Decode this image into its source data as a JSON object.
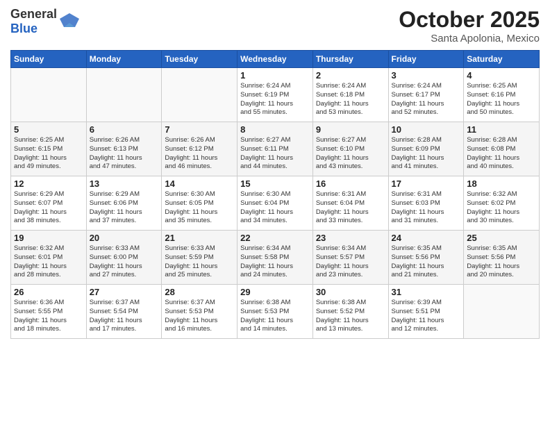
{
  "header": {
    "logo_general": "General",
    "logo_blue": "Blue",
    "month": "October 2025",
    "location": "Santa Apolonia, Mexico"
  },
  "weekdays": [
    "Sunday",
    "Monday",
    "Tuesday",
    "Wednesday",
    "Thursday",
    "Friday",
    "Saturday"
  ],
  "weeks": [
    [
      {
        "day": "",
        "info": ""
      },
      {
        "day": "",
        "info": ""
      },
      {
        "day": "",
        "info": ""
      },
      {
        "day": "1",
        "info": "Sunrise: 6:24 AM\nSunset: 6:19 PM\nDaylight: 11 hours\nand 55 minutes."
      },
      {
        "day": "2",
        "info": "Sunrise: 6:24 AM\nSunset: 6:18 PM\nDaylight: 11 hours\nand 53 minutes."
      },
      {
        "day": "3",
        "info": "Sunrise: 6:24 AM\nSunset: 6:17 PM\nDaylight: 11 hours\nand 52 minutes."
      },
      {
        "day": "4",
        "info": "Sunrise: 6:25 AM\nSunset: 6:16 PM\nDaylight: 11 hours\nand 50 minutes."
      }
    ],
    [
      {
        "day": "5",
        "info": "Sunrise: 6:25 AM\nSunset: 6:15 PM\nDaylight: 11 hours\nand 49 minutes."
      },
      {
        "day": "6",
        "info": "Sunrise: 6:26 AM\nSunset: 6:13 PM\nDaylight: 11 hours\nand 47 minutes."
      },
      {
        "day": "7",
        "info": "Sunrise: 6:26 AM\nSunset: 6:12 PM\nDaylight: 11 hours\nand 46 minutes."
      },
      {
        "day": "8",
        "info": "Sunrise: 6:27 AM\nSunset: 6:11 PM\nDaylight: 11 hours\nand 44 minutes."
      },
      {
        "day": "9",
        "info": "Sunrise: 6:27 AM\nSunset: 6:10 PM\nDaylight: 11 hours\nand 43 minutes."
      },
      {
        "day": "10",
        "info": "Sunrise: 6:28 AM\nSunset: 6:09 PM\nDaylight: 11 hours\nand 41 minutes."
      },
      {
        "day": "11",
        "info": "Sunrise: 6:28 AM\nSunset: 6:08 PM\nDaylight: 11 hours\nand 40 minutes."
      }
    ],
    [
      {
        "day": "12",
        "info": "Sunrise: 6:29 AM\nSunset: 6:07 PM\nDaylight: 11 hours\nand 38 minutes."
      },
      {
        "day": "13",
        "info": "Sunrise: 6:29 AM\nSunset: 6:06 PM\nDaylight: 11 hours\nand 37 minutes."
      },
      {
        "day": "14",
        "info": "Sunrise: 6:30 AM\nSunset: 6:05 PM\nDaylight: 11 hours\nand 35 minutes."
      },
      {
        "day": "15",
        "info": "Sunrise: 6:30 AM\nSunset: 6:04 PM\nDaylight: 11 hours\nand 34 minutes."
      },
      {
        "day": "16",
        "info": "Sunrise: 6:31 AM\nSunset: 6:04 PM\nDaylight: 11 hours\nand 33 minutes."
      },
      {
        "day": "17",
        "info": "Sunrise: 6:31 AM\nSunset: 6:03 PM\nDaylight: 11 hours\nand 31 minutes."
      },
      {
        "day": "18",
        "info": "Sunrise: 6:32 AM\nSunset: 6:02 PM\nDaylight: 11 hours\nand 30 minutes."
      }
    ],
    [
      {
        "day": "19",
        "info": "Sunrise: 6:32 AM\nSunset: 6:01 PM\nDaylight: 11 hours\nand 28 minutes."
      },
      {
        "day": "20",
        "info": "Sunrise: 6:33 AM\nSunset: 6:00 PM\nDaylight: 11 hours\nand 27 minutes."
      },
      {
        "day": "21",
        "info": "Sunrise: 6:33 AM\nSunset: 5:59 PM\nDaylight: 11 hours\nand 25 minutes."
      },
      {
        "day": "22",
        "info": "Sunrise: 6:34 AM\nSunset: 5:58 PM\nDaylight: 11 hours\nand 24 minutes."
      },
      {
        "day": "23",
        "info": "Sunrise: 6:34 AM\nSunset: 5:57 PM\nDaylight: 11 hours\nand 23 minutes."
      },
      {
        "day": "24",
        "info": "Sunrise: 6:35 AM\nSunset: 5:56 PM\nDaylight: 11 hours\nand 21 minutes."
      },
      {
        "day": "25",
        "info": "Sunrise: 6:35 AM\nSunset: 5:56 PM\nDaylight: 11 hours\nand 20 minutes."
      }
    ],
    [
      {
        "day": "26",
        "info": "Sunrise: 6:36 AM\nSunset: 5:55 PM\nDaylight: 11 hours\nand 18 minutes."
      },
      {
        "day": "27",
        "info": "Sunrise: 6:37 AM\nSunset: 5:54 PM\nDaylight: 11 hours\nand 17 minutes."
      },
      {
        "day": "28",
        "info": "Sunrise: 6:37 AM\nSunset: 5:53 PM\nDaylight: 11 hours\nand 16 minutes."
      },
      {
        "day": "29",
        "info": "Sunrise: 6:38 AM\nSunset: 5:53 PM\nDaylight: 11 hours\nand 14 minutes."
      },
      {
        "day": "30",
        "info": "Sunrise: 6:38 AM\nSunset: 5:52 PM\nDaylight: 11 hours\nand 13 minutes."
      },
      {
        "day": "31",
        "info": "Sunrise: 6:39 AM\nSunset: 5:51 PM\nDaylight: 11 hours\nand 12 minutes."
      },
      {
        "day": "",
        "info": ""
      }
    ]
  ]
}
